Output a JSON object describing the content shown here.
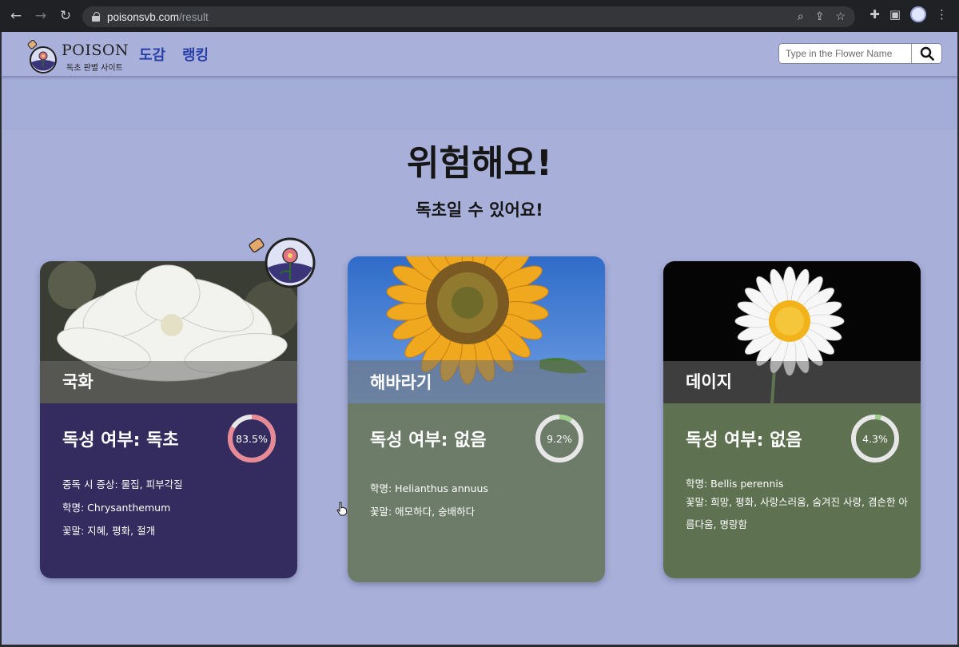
{
  "browser": {
    "url_host": "poisonsvb.com",
    "url_path": "/result"
  },
  "header": {
    "logo_title": "POISON",
    "logo_subtitle": "독초 판별 사이트",
    "menu": [
      "도감",
      "랭킹"
    ],
    "search_placeholder": "Type in the Flower Name"
  },
  "result": {
    "headline": "위험해요!",
    "subline": "독초일 수 있어요!"
  },
  "cards": [
    {
      "name": "국화",
      "toxicity": "독성 여부: 독초",
      "percent_label": "83.5%",
      "percent": 83.5,
      "body_color": "#342c5e",
      "ring_color": "#e88a96",
      "info": [
        "중독 시 증상: 물집, 피부각질",
        "학명: Chrysanthemum",
        "꽃말: 지혜, 평화, 절개"
      ]
    },
    {
      "name": "해바라기",
      "toxicity": "독성 여부: 없음",
      "percent_label": "9.2%",
      "percent": 9.2,
      "body_color": "#6c7c69",
      "ring_color": "#9fcf8f",
      "info": [
        "학명: Helianthus annuus",
        "꽃말: 애모하다, 숭배하다"
      ]
    },
    {
      "name": "데이지",
      "toxicity": "독성 여부: 없음",
      "percent_label": "4.3%",
      "percent": 4.3,
      "body_color": "#5e7151",
      "ring_color": "#9fcf8f",
      "info": [
        "학명: Bellis perennis",
        "꽃말: 희망, 평화, 사랑스러움, 숨겨진 사랑, 겸손한 아름다움, 명랑함"
      ]
    }
  ]
}
